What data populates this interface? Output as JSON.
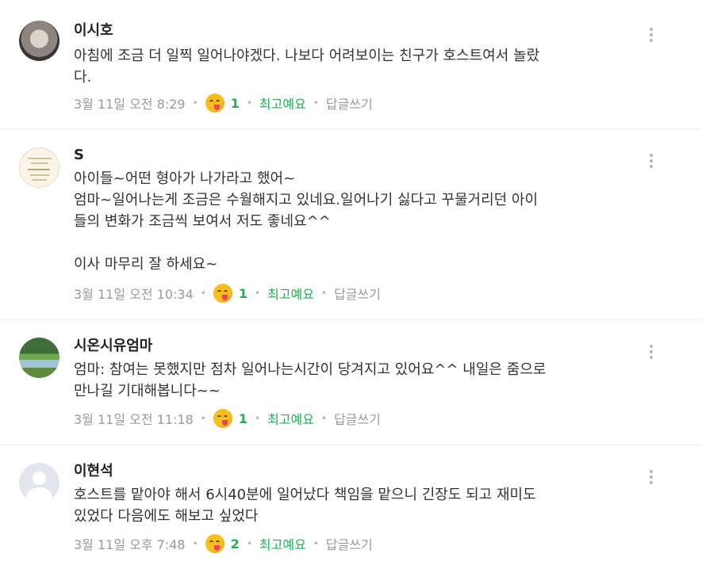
{
  "comments": [
    {
      "author": "이시호",
      "body": "아침에 조금 더 일찍 일어나야겠다. 나보다 어려보이는 친구가 호스트여서 놀랐\n다.",
      "timestamp": "3월 11일 오전 8:29",
      "reaction_icon": "smiling-face-with-tongue-icon",
      "reaction_count": "1",
      "best_label": "최고예요",
      "reply_label": "답글쓰기"
    },
    {
      "author": "S",
      "body": "아이들~어떤 형아가 나가라고 했어~\n엄마~일어나는게 조금은 수월해지고 있네요.일어나기 싫다고 꾸물거리던 아이\n들의 변화가 조금씩 보여서 저도 좋네요^^\n\n이사 마무리 잘 하세요~",
      "timestamp": "3월 11일 오전 10:34",
      "reaction_icon": "smiling-face-with-tongue-icon",
      "reaction_count": "1",
      "best_label": "최고예요",
      "reply_label": "답글쓰기"
    },
    {
      "author": "시온시유엄마",
      "body": "엄마: 참여는 못했지만 점차 일어나는시간이 당겨지고 있어요^^ 내일은 줌으로\n만나길 기대해봅니다~~",
      "timestamp": "3월 11일 오전 11:18",
      "reaction_icon": "smiling-face-with-tongue-icon",
      "reaction_count": "1",
      "best_label": "최고예요",
      "reply_label": "답글쓰기"
    },
    {
      "author": "이현석",
      "body": "호스트를 맡아야 해서 6시40분에 일어났다 책임을 맡으니 긴장도 되고 재미도\n있었다 다음에도 해보고 싶었다",
      "timestamp": "3월 11일 오후 7:48",
      "reaction_icon": "smiling-face-with-tongue-icon",
      "reaction_count": "2",
      "best_label": "최고예요",
      "reply_label": "답글쓰기"
    }
  ],
  "more_icon": "more-vertical-icon",
  "separator": "•",
  "colors": {
    "accent_green": "#1fb153",
    "meta_gray": "#9a9a9a",
    "divider": "#ececec"
  }
}
